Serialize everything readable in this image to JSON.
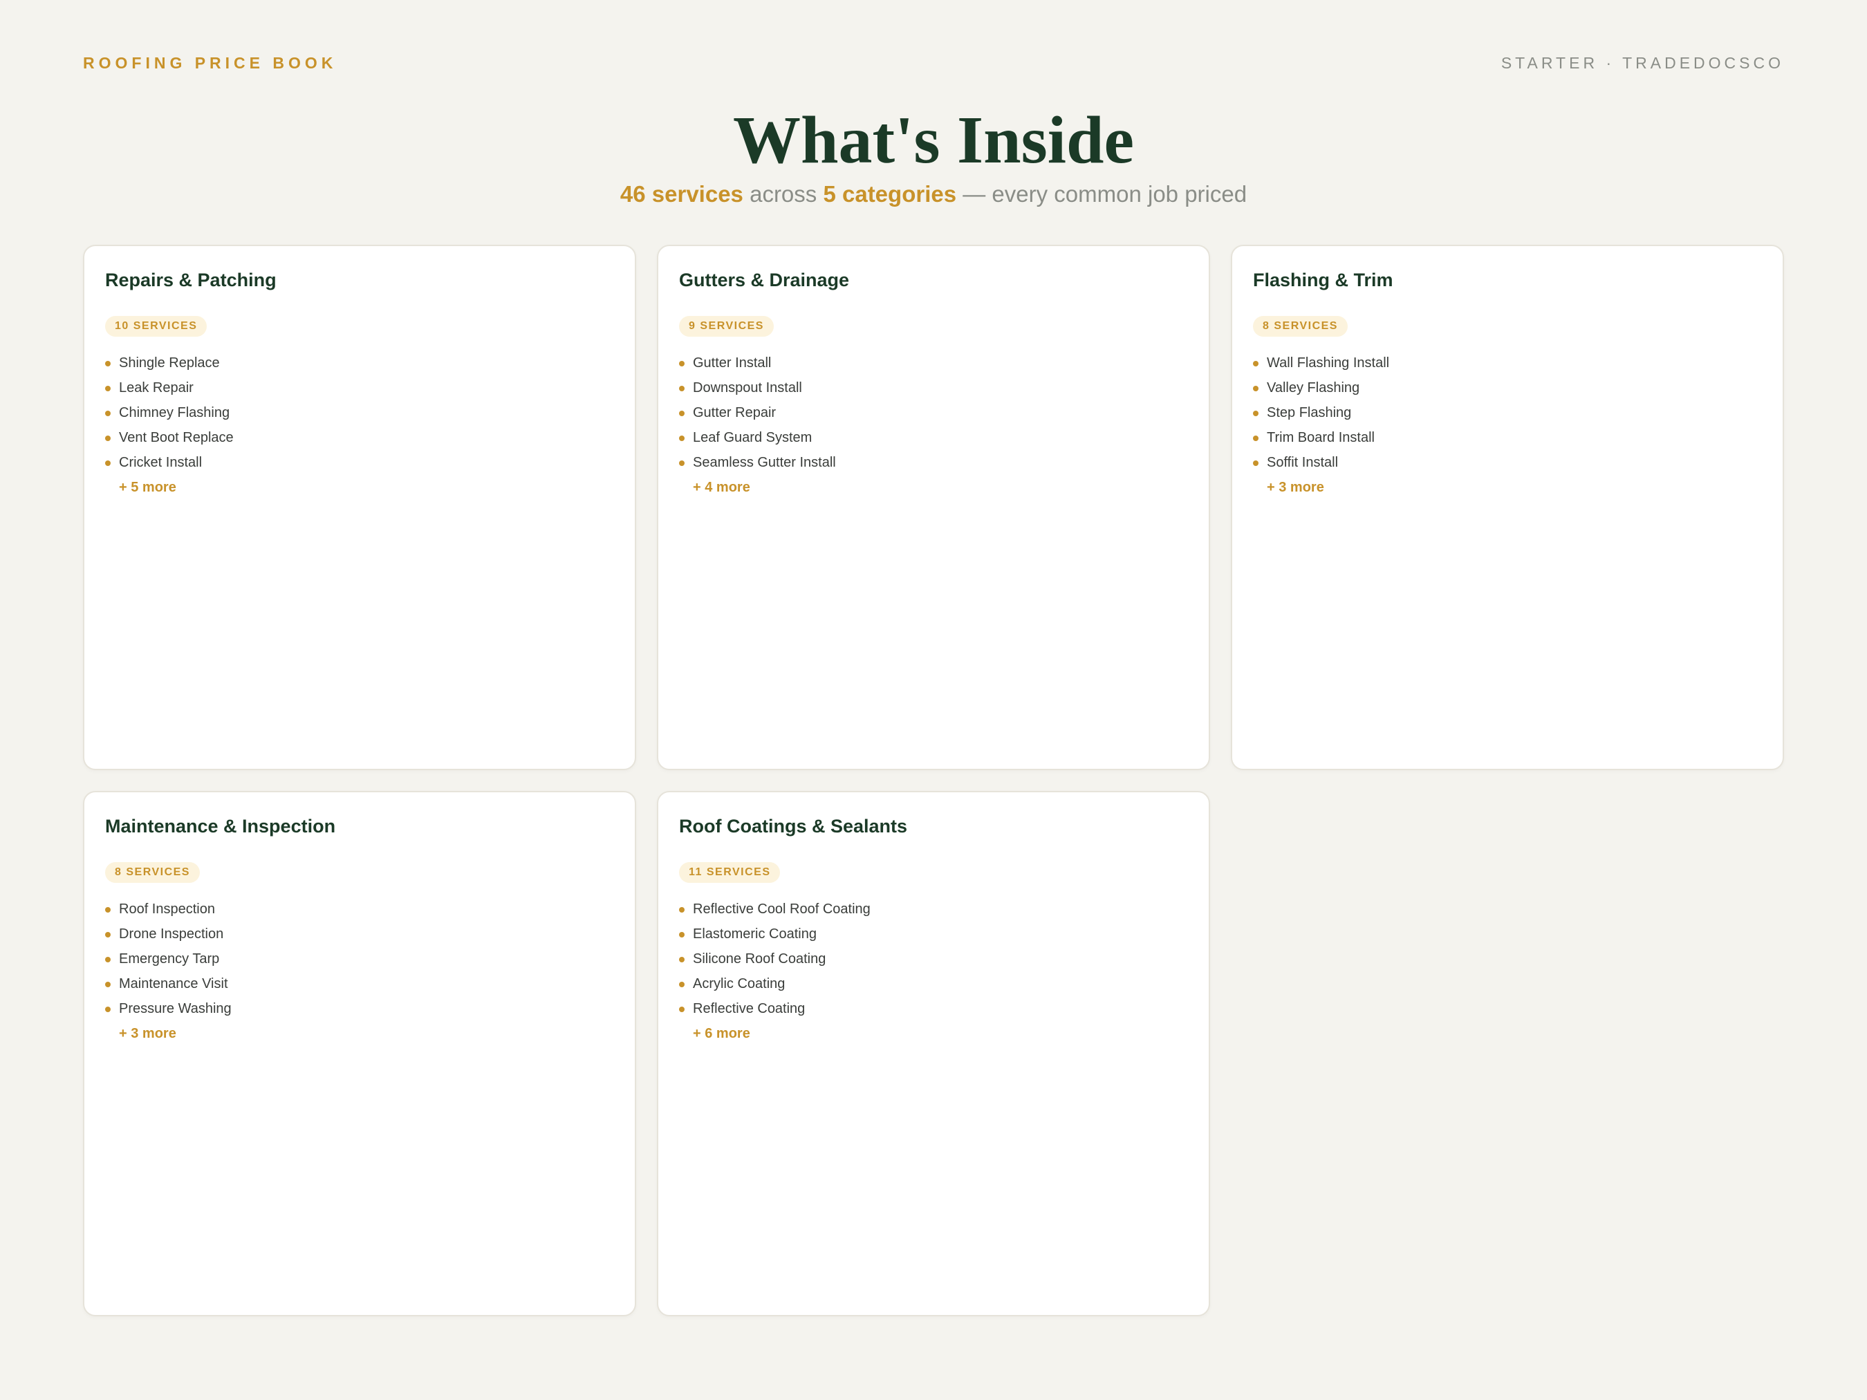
{
  "header": {
    "brand": "ROOFING PRICE BOOK",
    "edition": "STARTER · TRADEDOCSCO"
  },
  "hero": {
    "title": "What's Inside",
    "services_count": "46 services",
    "across": "across",
    "categories_count": "5 categories",
    "tagline": "— every common job priced"
  },
  "categories": [
    {
      "title": "Repairs & Patching",
      "badge": "10 SERVICES",
      "items": [
        "Shingle Replace",
        "Leak Repair",
        "Chimney Flashing",
        "Vent Boot Replace",
        "Cricket Install"
      ],
      "more": "+ 5 more"
    },
    {
      "title": "Gutters & Drainage",
      "badge": "9 SERVICES",
      "items": [
        "Gutter Install",
        "Downspout Install",
        "Gutter Repair",
        "Leaf Guard System",
        "Seamless Gutter Install"
      ],
      "more": "+ 4 more"
    },
    {
      "title": "Flashing & Trim",
      "badge": "8 SERVICES",
      "items": [
        "Wall Flashing Install",
        "Valley Flashing",
        "Step Flashing",
        "Trim Board Install",
        "Soffit Install"
      ],
      "more": "+ 3 more"
    },
    {
      "title": "Maintenance & Inspection",
      "badge": "8 SERVICES",
      "items": [
        "Roof Inspection",
        "Drone Inspection",
        "Emergency Tarp",
        "Maintenance Visit",
        "Pressure Washing"
      ],
      "more": "+ 3 more"
    },
    {
      "title": "Roof Coatings & Sealants",
      "badge": "11 SERVICES",
      "items": [
        "Reflective Cool Roof Coating",
        "Elastomeric Coating",
        "Silicone Roof Coating",
        "Acrylic Coating",
        "Reflective Coating"
      ],
      "more": "+ 6 more"
    }
  ],
  "colors": {
    "accent": "#c8922a",
    "heading": "#1b3a27",
    "background": "#f4f3ee"
  }
}
